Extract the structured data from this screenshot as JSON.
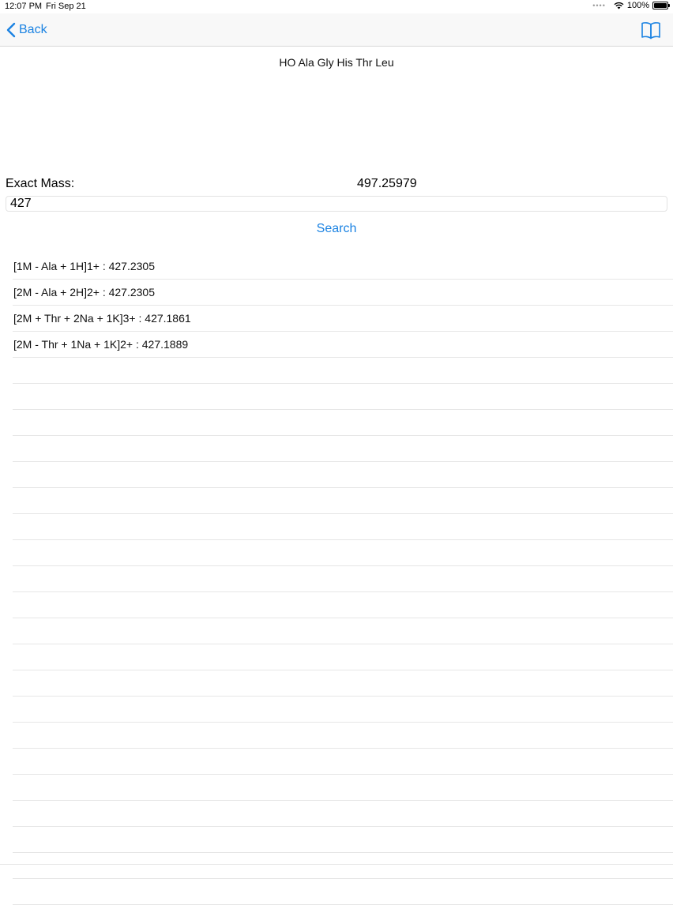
{
  "status": {
    "time": "12:07 PM",
    "date": "Fri Sep 21",
    "battery": "100%"
  },
  "nav": {
    "back_label": "Back",
    "right_icon": "book-icon",
    "accent_color": "#1a82e2"
  },
  "peptide": "HO Ala Gly His Thr Leu",
  "mass": {
    "label": "Exact Mass:",
    "value": "497.25979"
  },
  "search": {
    "value": "427",
    "button_label": "Search"
  },
  "results": [
    "[1M - Ala + 1H]1+ : 427.2305",
    "[2M - Ala + 2H]2+ : 427.2305",
    "[2M + Thr + 2Na + 1K]3+ : 427.1861",
    "[2M - Thr + 1Na + 1K]2+ : 427.1889",
    "",
    "",
    "",
    "",
    "",
    "",
    "",
    "",
    "",
    "",
    "",
    "",
    "",
    "",
    "",
    "",
    "",
    "",
    "",
    "",
    ""
  ]
}
